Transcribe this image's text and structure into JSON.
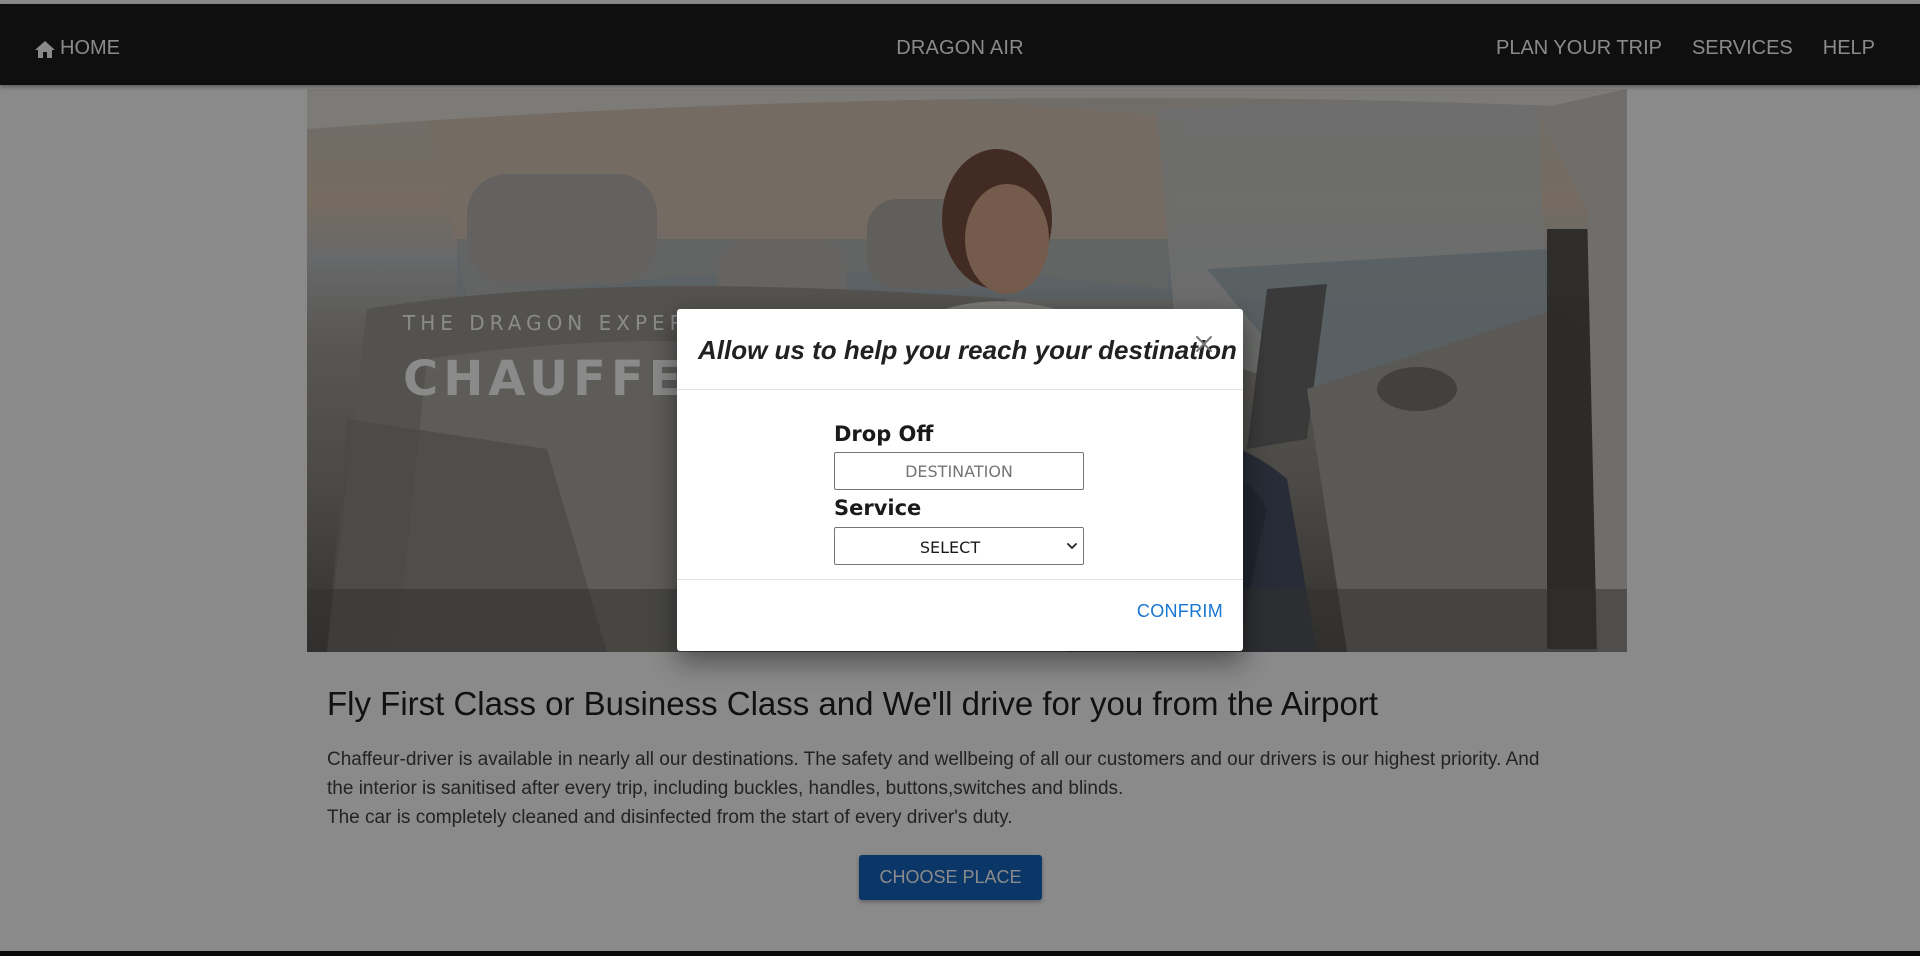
{
  "navbar": {
    "home_label": "HOME",
    "home_icon": "home-icon",
    "brand": "DRAGON AIR",
    "links": [
      "PLAN YOUR TRIP",
      "SERVICES",
      "HELP"
    ]
  },
  "hero": {
    "kicker": "THE DRAGON EXPERIENCE",
    "title": "CHAUFFEUR"
  },
  "section": {
    "heading": "Fly First Class or Business Class and We'll drive for you from the Airport",
    "paragraph_1": "Chaffeur-driver is available in nearly all our destinations. The safety and wellbeing of all our customers and our drivers is our highest priority. And the interior is sanitised after every trip, including buckles, handles, buttons,switches and blinds.",
    "paragraph_2": "The car is completely cleaned and disinfected from the start of every driver's duty.",
    "button_label": "CHOOSE PLACE"
  },
  "modal": {
    "title": "Allow us to help you reach your destination",
    "close_icon": "close-icon",
    "dropoff_label": "Drop Off",
    "destination_placeholder": "DESTINATION",
    "destination_value": "",
    "service_label": "Service",
    "service_selected": "SELECT",
    "confirm_label": "CONFRIM"
  },
  "colors": {
    "navbar_bg": "#1c1c1c",
    "primary_button": "#1565c0",
    "confirm_text": "#1976d2",
    "overlay": "rgba(0,0,0,0.46)"
  }
}
